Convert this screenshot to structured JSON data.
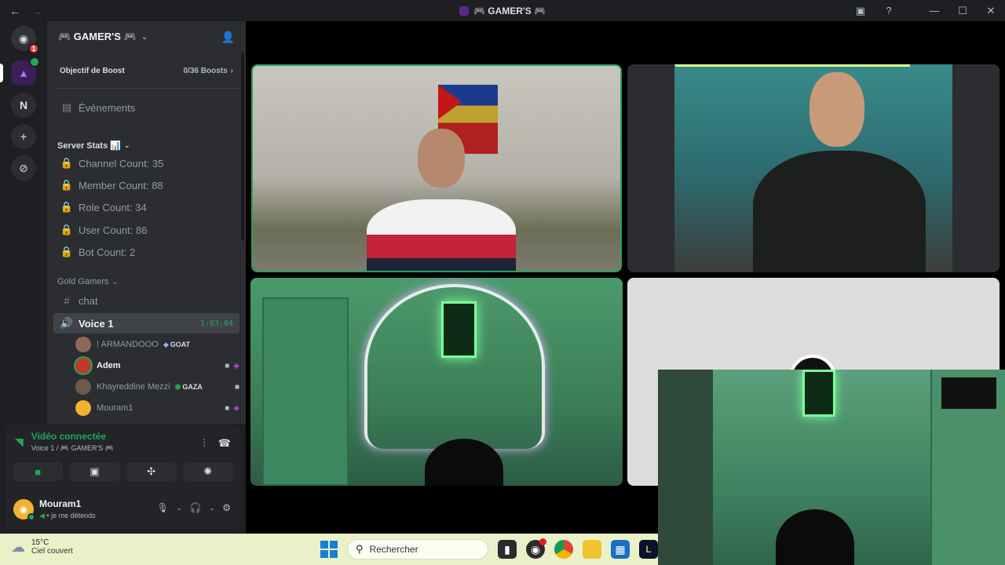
{
  "titlebar": {
    "title": "🎮 GAMER'S 🎮",
    "back": "←",
    "forward": "→"
  },
  "guilds": {
    "home_badge": "1",
    "n_label": "N"
  },
  "server": {
    "name": "🎮 GAMER'S 🎮",
    "boost_label": "Objectif de Boost",
    "boost_count": "0/36 Boosts",
    "events_label": "Événements",
    "categories": [
      {
        "name": "Server Stats 📊"
      },
      {
        "name": "Gold Gamers"
      }
    ],
    "stats_channels": [
      "Channel Count: 35",
      "Member Count: 88",
      "Role Count: 34",
      "User Count: 86",
      "Bot Count: 2"
    ],
    "text_channel": "chat",
    "voice_channel": {
      "name": "Voice 1",
      "timer": "1:03:04"
    },
    "voice_users": [
      {
        "name": "! ARMANDOOO",
        "tag": "GOAT",
        "avatar_color": "#8c6a5a"
      },
      {
        "name": "Adem",
        "avatar_color": "#c0392b"
      },
      {
        "name": "Khayreddine Mezzi",
        "tag": "GAZA",
        "avatar_color": "#6d5a4e"
      },
      {
        "name": "Mouram1",
        "avatar_color": "#f0b232"
      }
    ]
  },
  "rtc": {
    "status": "Vidéo connectée",
    "location": "Voice 1 / 🎮 GAMER'S 🎮"
  },
  "user": {
    "name": "Mouram1",
    "status": "je me détends"
  },
  "taskbar": {
    "temperature": "15°C",
    "weather": "Ciel couvert",
    "search": "Rechercher"
  },
  "colors": {
    "accent_green": "#23a55a",
    "background": "#1e1f22",
    "sidebar": "#2b2d31",
    "taskbar": "#eaf0c8"
  }
}
